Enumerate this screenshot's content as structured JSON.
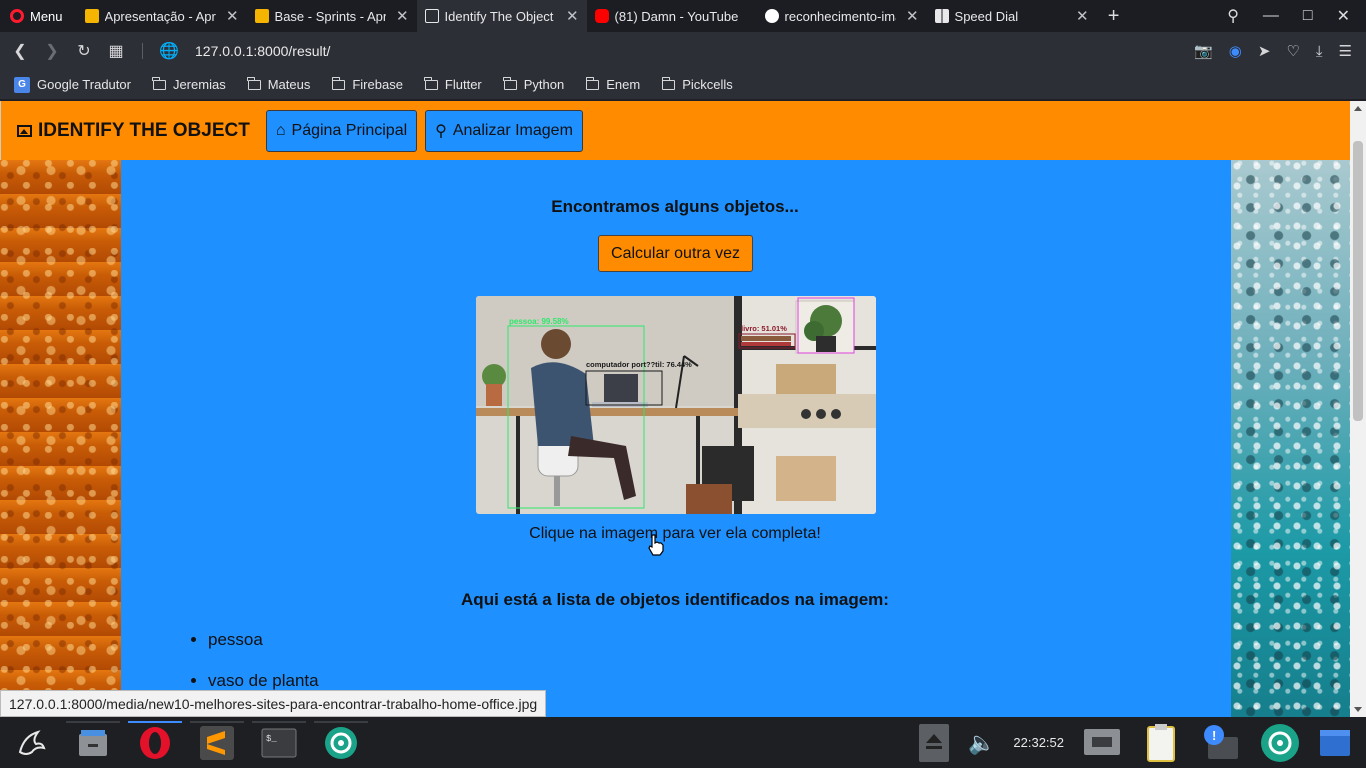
{
  "browser": {
    "menu_label": "Menu",
    "tabs": [
      {
        "title": "Apresentação - Apr",
        "favicon_color": "#f5b400"
      },
      {
        "title": "Base - Sprints - Apre",
        "favicon_color": "#f5b400"
      },
      {
        "title": "Identify The Object",
        "favicon_color": "#e8e8ea",
        "active": true
      },
      {
        "title": "(81) Damn - YouTube",
        "favicon_color": "#ff0000"
      },
      {
        "title": "reconhecimento-ima",
        "favicon_color": "#ffffff"
      },
      {
        "title": "Speed Dial",
        "favicon_color": "#e8e8ea"
      }
    ],
    "url": "127.0.0.1:8000/result/",
    "bookmarks": [
      "Google Tradutor",
      "Jeremias",
      "Mateus",
      "Firebase",
      "Flutter",
      "Python",
      "Enem",
      "Pickcells"
    ],
    "status_url": "127.0.0.1:8000/media/new10-melhores-sites-para-encontrar-trabalho-home-office.jpg"
  },
  "page": {
    "brand": "IDENTIFY THE OBJECT",
    "nav": {
      "home_label": "Página Principal",
      "analyze_label": "Analizar Imagem"
    },
    "heading": "Encontramos alguns objetos...",
    "recalc_label": "Calcular outra vez",
    "detections": [
      {
        "label": "pessoa: 99.58%",
        "color": "#2ee86a"
      },
      {
        "label": "computador port??til: 76.44%",
        "color": "#1a1a1a"
      },
      {
        "label": "livro: 51.01%",
        "color": "#8b1a2a"
      },
      {
        "label": "",
        "color": "#e040e0"
      }
    ],
    "caption": "Clique na imagem para ver ela completa!",
    "list_title": "Aqui está a lista de objetos identificados na imagem:",
    "objects": [
      "pessoa",
      "vaso de planta"
    ]
  },
  "taskbar": {
    "clock": "22:32:52"
  }
}
